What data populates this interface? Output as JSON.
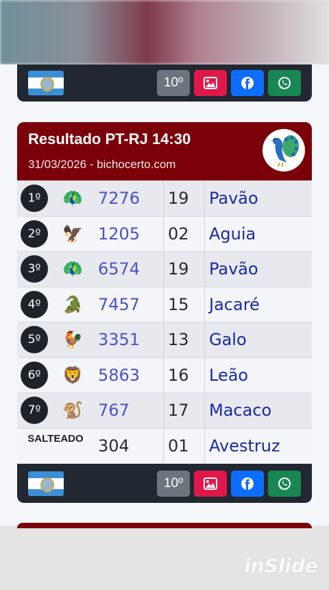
{
  "top_bar": {
    "flag_icon": "rio-de-janeiro-flag-icon",
    "buttons": [
      {
        "label": "10º",
        "color": "#6c757d"
      },
      {
        "icon": "image-icon",
        "color": "#e0184a"
      },
      {
        "icon": "facebook-icon",
        "color": "#0d6efd"
      },
      {
        "icon": "whatsapp-icon",
        "color": "#198754"
      }
    ]
  },
  "result_card": {
    "title": "Resultado PT-RJ 14:30",
    "subtitle": "31/03/2026 - bichocerto.com",
    "header_color": "#7a0009",
    "badge_icon": "peacock-icon",
    "rows": [
      {
        "position": "1º",
        "animal_icon": "🦚",
        "number": "7276",
        "group": "19",
        "animal": "Pavão"
      },
      {
        "position": "2º",
        "animal_icon": "🦅",
        "number": "1205",
        "group": "02",
        "animal": "Aguia"
      },
      {
        "position": "3º",
        "animal_icon": "🦚",
        "number": "6574",
        "group": "19",
        "animal": "Pavão"
      },
      {
        "position": "4º",
        "animal_icon": "🐊",
        "number": "7457",
        "group": "15",
        "animal": "Jacaré"
      },
      {
        "position": "5º",
        "animal_icon": "🐓",
        "number": "3351",
        "group": "13",
        "animal": "Galo"
      },
      {
        "position": "6º",
        "animal_icon": "🦁",
        "number": "5863",
        "group": "16",
        "animal": "Leão"
      },
      {
        "position": "7º",
        "animal_icon": "🐒",
        "number": "767",
        "group": "17",
        "animal": "Macaco"
      }
    ],
    "salteado": {
      "label": "SALTEADO",
      "number": "304",
      "group": "01",
      "animal": "Avestruz"
    }
  },
  "bottom_bar": {
    "buttons": [
      {
        "label": "10º"
      },
      {
        "icon": "image-icon"
      },
      {
        "icon": "facebook-icon"
      },
      {
        "icon": "whatsapp-icon"
      }
    ]
  },
  "watermark": "inSlide"
}
